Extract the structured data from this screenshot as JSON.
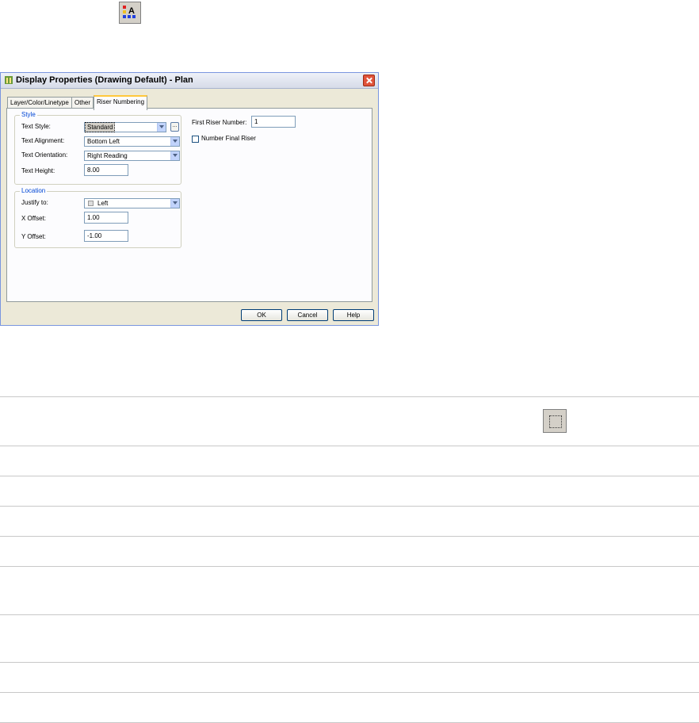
{
  "top_icon": {
    "name": "text-style-icon"
  },
  "dialog": {
    "title": "Display Properties (Drawing Default) - Plan",
    "tabs": [
      {
        "label": "Layer/Color/Linetype",
        "active": false
      },
      {
        "label": "Other",
        "active": false
      },
      {
        "label": "Riser Numbering",
        "active": true
      }
    ],
    "style_group": {
      "title": "Style",
      "text_style_label": "Text Style:",
      "text_style_value": "Standard",
      "browse_label": "...",
      "text_alignment_label": "Text Alignment:",
      "text_alignment_value": "Bottom Left",
      "text_orientation_label": "Text Orientation:",
      "text_orientation_value": "Right Reading",
      "text_height_label": "Text Height:",
      "text_height_value": "8.00"
    },
    "location_group": {
      "title": "Location",
      "justify_label": "Justify to:",
      "justify_value": "Left",
      "x_offset_label": "X Offset:",
      "x_offset_value": "1.00",
      "y_offset_label": "Y Offset:",
      "y_offset_value": "-1.00"
    },
    "first_riser_label": "First Riser Number:",
    "first_riser_value": "1",
    "number_final_riser_label": "Number Final Riser",
    "number_final_riser_checked": false,
    "buttons": {
      "ok": "OK",
      "cancel": "Cancel",
      "help": "Help"
    }
  },
  "table": {
    "row_icon_name": "dotted-frame-icon"
  },
  "colors": {
    "title_close": "#e0533a",
    "tab_highlight": "#ffc83c",
    "group_title": "#0046d5"
  }
}
